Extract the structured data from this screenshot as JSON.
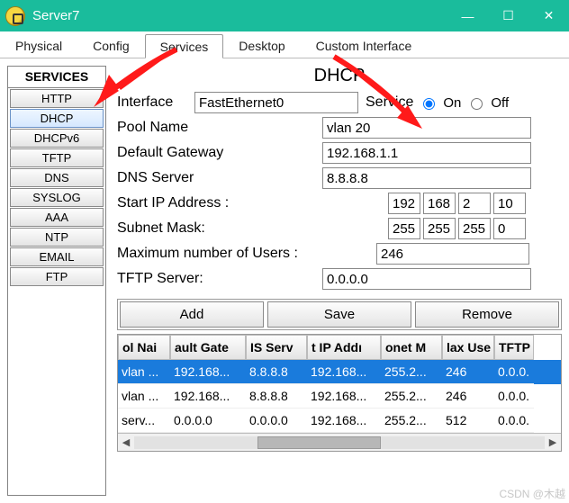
{
  "window": {
    "title": "Server7",
    "minimize": "—",
    "maximize": "☐",
    "close": "✕"
  },
  "tabs": [
    "Physical",
    "Config",
    "Services",
    "Desktop",
    "Custom Interface"
  ],
  "active_tab": "Services",
  "sidebar": {
    "header": "SERVICES",
    "items": [
      "HTTP",
      "DHCP",
      "DHCPv6",
      "TFTP",
      "DNS",
      "SYSLOG",
      "AAA",
      "NTP",
      "EMAIL",
      "FTP"
    ],
    "active": "DHCP"
  },
  "dhcp": {
    "title": "DHCP",
    "interface_label": "Interface",
    "interface_value": "FastEthernet0",
    "service_label": "Service",
    "on_label": "On",
    "off_label": "Off",
    "service_on": true,
    "pool_label": "Pool Name",
    "pool_value": "vlan 20",
    "gateway_label": "Default Gateway",
    "gateway_value": "192.168.1.1",
    "dns_label": "DNS Server",
    "dns_value": "8.8.8.8",
    "start_label": "Start IP Address :",
    "start_octets": [
      "192",
      "168",
      "2",
      "10"
    ],
    "mask_label": "Subnet Mask:",
    "mask_octets": [
      "255",
      "255",
      "255",
      "0"
    ],
    "maxusers_label": "Maximum number of Users :",
    "maxusers_value": "246",
    "tftp_label": "TFTP Server:",
    "tftp_value": "0.0.0.0",
    "buttons": {
      "add": "Add",
      "save": "Save",
      "remove": "Remove"
    },
    "grid": {
      "headers": [
        "ol Nai",
        "ault Gate",
        "IS Serv",
        "t IP Addı",
        "onet M",
        "lax Use",
        "TFTP"
      ],
      "rows": [
        {
          "cells": [
            "vlan ...",
            "192.168...",
            "8.8.8.8",
            "192.168...",
            "255.2...",
            "246",
            "0.0.0."
          ],
          "selected": true
        },
        {
          "cells": [
            "vlan ...",
            "192.168...",
            "8.8.8.8",
            "192.168...",
            "255.2...",
            "246",
            "0.0.0."
          ],
          "selected": false
        },
        {
          "cells": [
            "serv...",
            "0.0.0.0",
            "0.0.0.0",
            "192.168...",
            "255.2...",
            "512",
            "0.0.0."
          ],
          "selected": false
        }
      ]
    }
  },
  "watermark": "CSDN @木越"
}
